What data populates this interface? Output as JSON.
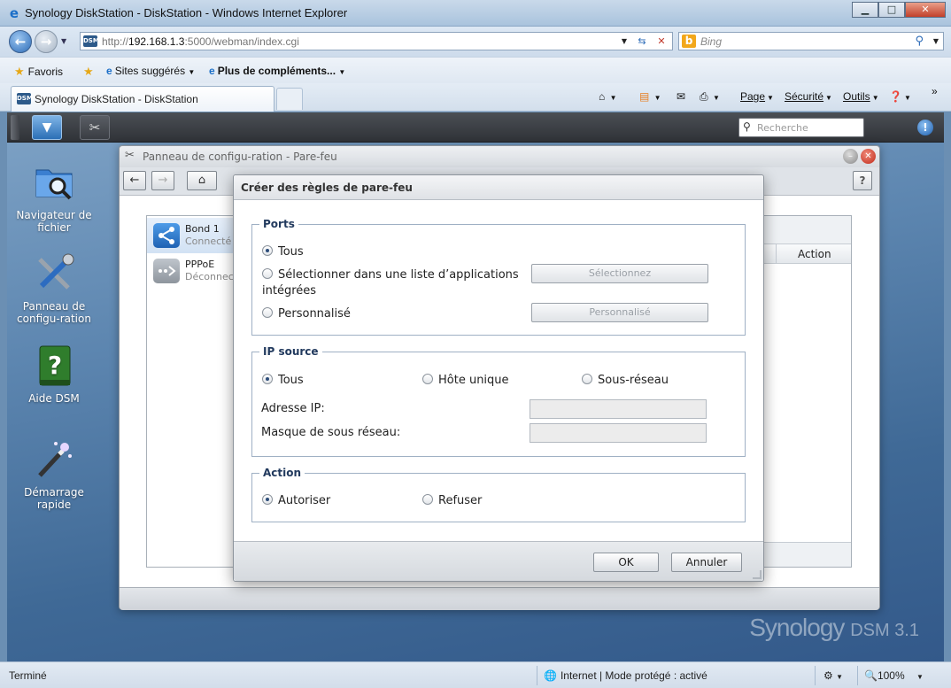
{
  "browser": {
    "window_title": "Synology DiskStation - DiskStation - Windows Internet Explorer",
    "url_prefix": "http://",
    "url_host": "192.168.1.3",
    "url_rest": ":5000/webman/index.cgi",
    "favicon_text": "DSM",
    "search_placeholder": "Bing",
    "favorites_label": "Favoris",
    "suggested_sites": "Sites suggérés",
    "more_addons": "Plus de compléments...",
    "tab_title": "Synology DiskStation - DiskStation",
    "commands": {
      "page": "Page",
      "security": "Sécurité",
      "tools": "Outils"
    },
    "status_left": "Terminé",
    "status_zone": "Internet | Mode protégé : activé",
    "zoom": "100%"
  },
  "dsm": {
    "search_placeholder": "Recherche",
    "watermark": "Synology",
    "watermark_suffix": "DSM 3.1",
    "desktop_icons": [
      {
        "label": "Navigateur de fichier",
        "icon": "folder-search-icon"
      },
      {
        "label": "Panneau de configu-ration",
        "icon": "tools-icon"
      },
      {
        "label": "Aide DSM",
        "icon": "help-book-icon"
      },
      {
        "label": "Démarrage rapide",
        "icon": "magic-wand-icon"
      }
    ]
  },
  "control_panel": {
    "title": "Panneau de configu-ration - Pare-feu",
    "interfaces": [
      {
        "name": "Bond 1",
        "status": "Connecté"
      },
      {
        "name": "PPPoE",
        "status": "Déconnecté"
      }
    ],
    "column_action": "Action"
  },
  "dialog": {
    "title": "Créer des règles de pare-feu",
    "ports": {
      "legend": "Ports",
      "opt_all": "Tous",
      "opt_list": "Sélectionner dans une liste d’applications",
      "opt_list_cont": "intégrées",
      "opt_custom": "Personnalisé",
      "btn_select": "Sélectionnez",
      "btn_custom": "Personnalisé"
    },
    "source_ip": {
      "legend": "IP source",
      "opt_all": "Tous",
      "opt_single": "Hôte unique",
      "opt_subnet": "Sous-réseau",
      "ip_label": "Adresse IP:",
      "mask_label": "Masque de sous réseau:"
    },
    "action": {
      "legend": "Action",
      "opt_allow": "Autoriser",
      "opt_deny": "Refuser"
    },
    "ok": "OK",
    "cancel": "Annuler"
  }
}
